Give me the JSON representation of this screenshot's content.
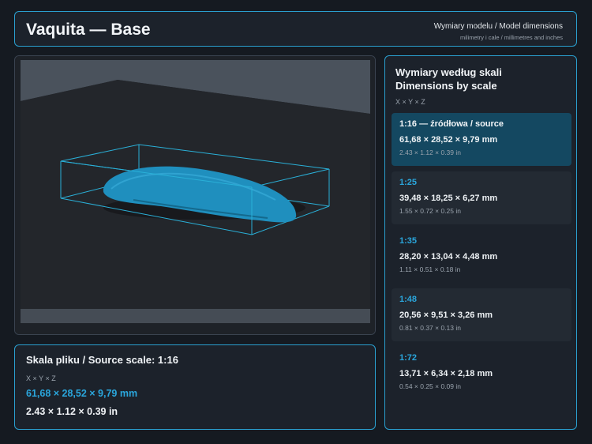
{
  "header": {
    "title": "Vaquita — Base",
    "subtitle": "Wymiary modelu / Model dimensions",
    "units_note": "milimetry i cale / millimetres and inches"
  },
  "viewer": {
    "model_color": "#1f8fbe",
    "bbox_color": "#2ab0d8"
  },
  "source": {
    "title": "Skala pliku / Source scale: 1:16",
    "axes": "X × Y × Z",
    "mm": "61,68 × 28,52 × 9,79 mm",
    "inches": "2.43 × 1.12 × 0.39 in"
  },
  "scales": {
    "heading_line1": "Wymiary według skali",
    "heading_line2": "Dimensions by scale",
    "axes": "X × Y × Z",
    "items": [
      {
        "label": "1:16  —  źródłowa / source",
        "mm": "61,68 × 28,52 × 9,79 mm",
        "inches": "2.43 × 1.12 × 0.39 in",
        "active": true
      },
      {
        "label": "1:25",
        "mm": "39,48 × 18,25 × 6,27 mm",
        "inches": "1.55 × 0.72 × 0.25 in",
        "active": false
      },
      {
        "label": "1:35",
        "mm": "28,20 × 13,04 × 4,48 mm",
        "inches": "1.11 × 0.51 × 0.18 in",
        "active": false
      },
      {
        "label": "1:48",
        "mm": "20,56 × 9,51 × 3,26 mm",
        "inches": "0.81 × 0.37 × 0.13 in",
        "active": false
      },
      {
        "label": "1:72",
        "mm": "13,71 × 6,34 × 2,18 mm",
        "inches": "0.54 × 0.25 × 0.09 in",
        "active": false
      }
    ]
  }
}
